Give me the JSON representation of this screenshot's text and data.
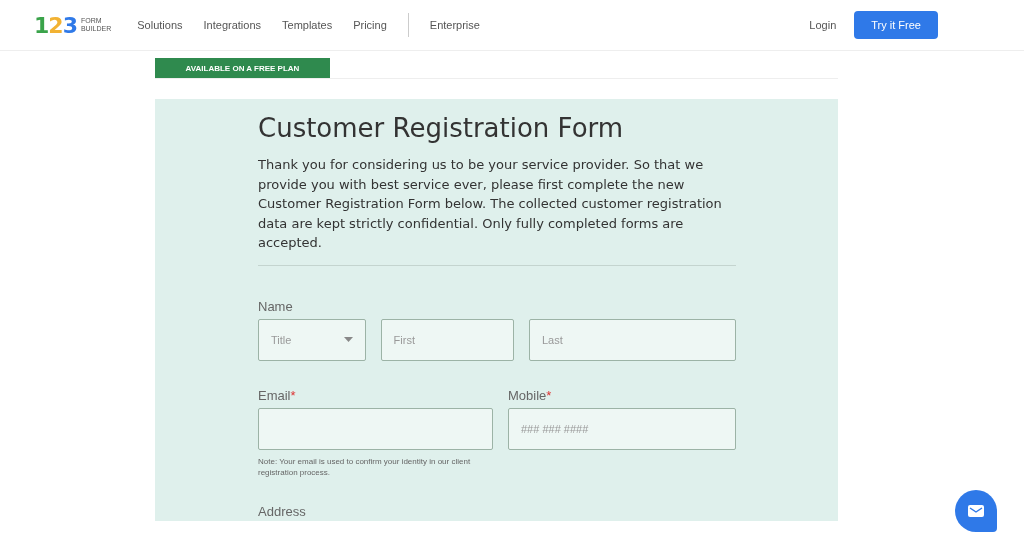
{
  "header": {
    "logo": {
      "digits": "123",
      "word_top": "FORM",
      "word_bottom": "BUILDER"
    },
    "nav": [
      "Solutions",
      "Integrations",
      "Templates",
      "Pricing",
      "Enterprise"
    ],
    "login": "Login",
    "cta": "Try it Free"
  },
  "badge": "AVAILABLE ON A FREE PLAN",
  "form": {
    "title": "Customer Registration Form",
    "intro": "Thank you for considering us to be your service provider. So that we provide you with best service ever, please first complete the new Customer Registration Form below. The collected customer registration data are kept strictly confidential. Only fully completed forms are accepted.",
    "rows": [
      {
        "label": "Name",
        "required_mark": null,
        "fields": [
          {
            "kind": "select",
            "placeholder": "Title"
          },
          {
            "kind": "text",
            "placeholder": "First"
          },
          {
            "kind": "text",
            "placeholder": "Last"
          }
        ]
      },
      {
        "kind": "pair",
        "groups": [
          {
            "label": "Email",
            "required_mark": "*",
            "field": {
              "kind": "text"
            },
            "note": "Note: Your email is used to confirm your identity in our client registration process."
          },
          {
            "label": "Mobile",
            "required_mark": "*",
            "field": {
              "kind": "text",
              "placeholder": "### ### ####"
            }
          }
        ]
      },
      {
        "label": "Address",
        "required_mark": null
      }
    ]
  }
}
